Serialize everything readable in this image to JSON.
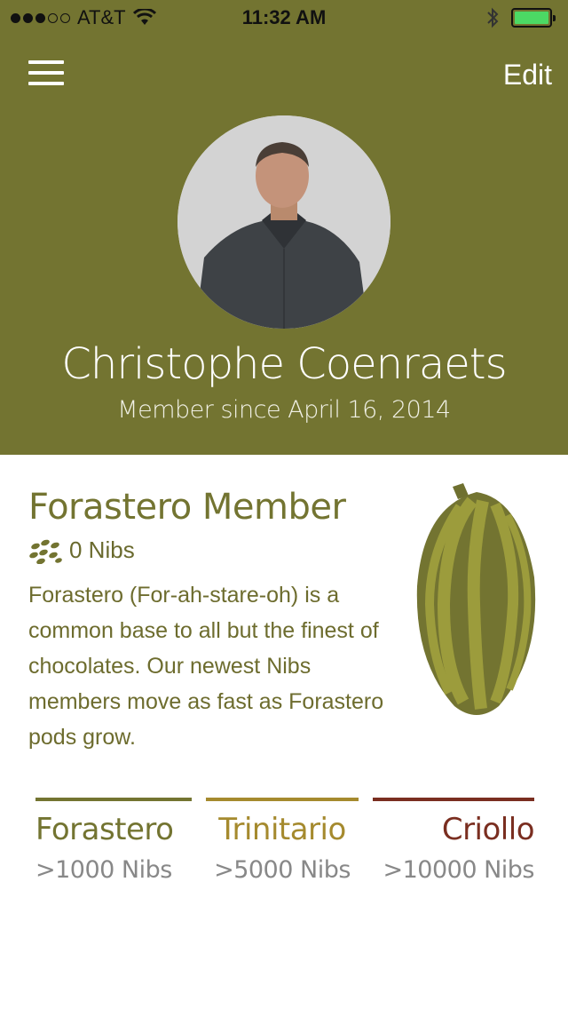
{
  "status_bar": {
    "carrier": "AT&T",
    "time": "11:32 AM",
    "signal_bars_filled": 3,
    "signal_bars_total": 5,
    "battery_level": 1.0
  },
  "header": {
    "menu_icon": "hamburger-menu-icon",
    "edit_label": "Edit",
    "background_color": "#737431"
  },
  "profile": {
    "name": "Christophe Coenraets",
    "member_since": "Member since April 16, 2014"
  },
  "membership": {
    "title": "Forastero Member",
    "nibs_icon": "nibs-icon",
    "nibs_count": "0 Nibs",
    "description": "Forastero (For-ah-stare-oh) is a common base to all but the finest of chocolates. Our newest Nibs members move as fast as Forastero pods grow."
  },
  "levels": [
    {
      "name": "Forastero",
      "requirement": ">1000 Nibs",
      "color": "#737431"
    },
    {
      "name": "Trinitario",
      "requirement": ">5000 Nibs",
      "color": "#a58a2e"
    },
    {
      "name": "Criollo",
      "requirement": ">10000 Nibs",
      "color": "#7a2e20"
    }
  ]
}
